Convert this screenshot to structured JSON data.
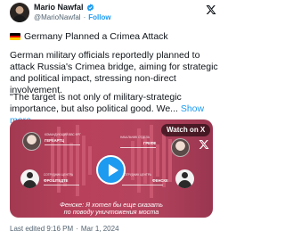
{
  "author": {
    "name": "Mario Nawfal",
    "handle": "@MarioNawfal",
    "separator": "·",
    "follow_label": "Follow"
  },
  "post": {
    "headline": "Germany Planned a Crimea Attack",
    "paragraph1": "German military officials reportedly planned to attack Russia's Crimea bridge, aiming for strategic and political impact, stressing non-direct involvement.",
    "paragraph2": "\"The target is not only of military-strategic importance, but also political good. We...",
    "show_more": "Show more",
    "flag_colors": [
      "#000000",
      "#dd0000",
      "#ffce00"
    ]
  },
  "video": {
    "watch_label": "Watch on X",
    "subtitle_line1": "Фенске: Я хотел бы еще сказать",
    "subtitle_line2": "по поводу уничтожения моста",
    "speakers": [
      {
        "label": "КОМАНДУЮЩИЙ ВВС ФРГ",
        "name": "ГЕРХАРТЦ"
      },
      {
        "label": "НАЧАЛЬНИК ОТДЕЛА",
        "name": "ГРЕФЕ"
      },
      {
        "label": "СОТРУДНИК ЦЕНТРА",
        "name": "ФРОШТЕДТЕ"
      },
      {
        "label": "СОТРУДНИК ЦЕНТРА",
        "name": "ФЕНСКЕ"
      }
    ],
    "accent_color": "#1d9bf0"
  },
  "footer": {
    "edited": "Last edited 9:16 PM",
    "separator": "·",
    "date": "Mar 1, 2024"
  }
}
